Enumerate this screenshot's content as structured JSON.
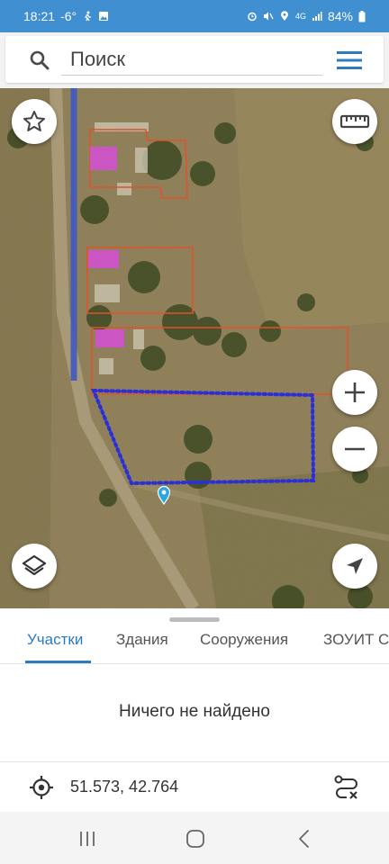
{
  "status_bar": {
    "time": "18:21",
    "temperature": "-6°",
    "signal_label": "4G",
    "battery": "84%"
  },
  "search": {
    "placeholder": "Поиск"
  },
  "map": {
    "icons": {
      "favorite": "star-icon",
      "ruler": "ruler-icon",
      "zoom_in": "plus-icon",
      "zoom_out": "minus-icon",
      "layers": "layers-icon",
      "locate": "navigation-arrow-icon",
      "marker": "map-pin-icon"
    },
    "colors": {
      "parcel_outline": "#e0532c",
      "selected_parcel": "#2b2fd6",
      "building_fill": "#d64fd6",
      "road": "#3a58c9",
      "marker": "#2aa6e0"
    }
  },
  "tabs": [
    {
      "label": "Участки",
      "active": true
    },
    {
      "label": "Здания",
      "active": false
    },
    {
      "label": "Сооружения",
      "active": false
    },
    {
      "label": "ЗОУИТ С",
      "active": false
    }
  ],
  "results": {
    "empty_message": "Ничего не найдено"
  },
  "coordinates": {
    "value": "51.573, 42.764"
  },
  "accent_color": "#2a7bbf",
  "statusbar_color": "#3f8fd1"
}
